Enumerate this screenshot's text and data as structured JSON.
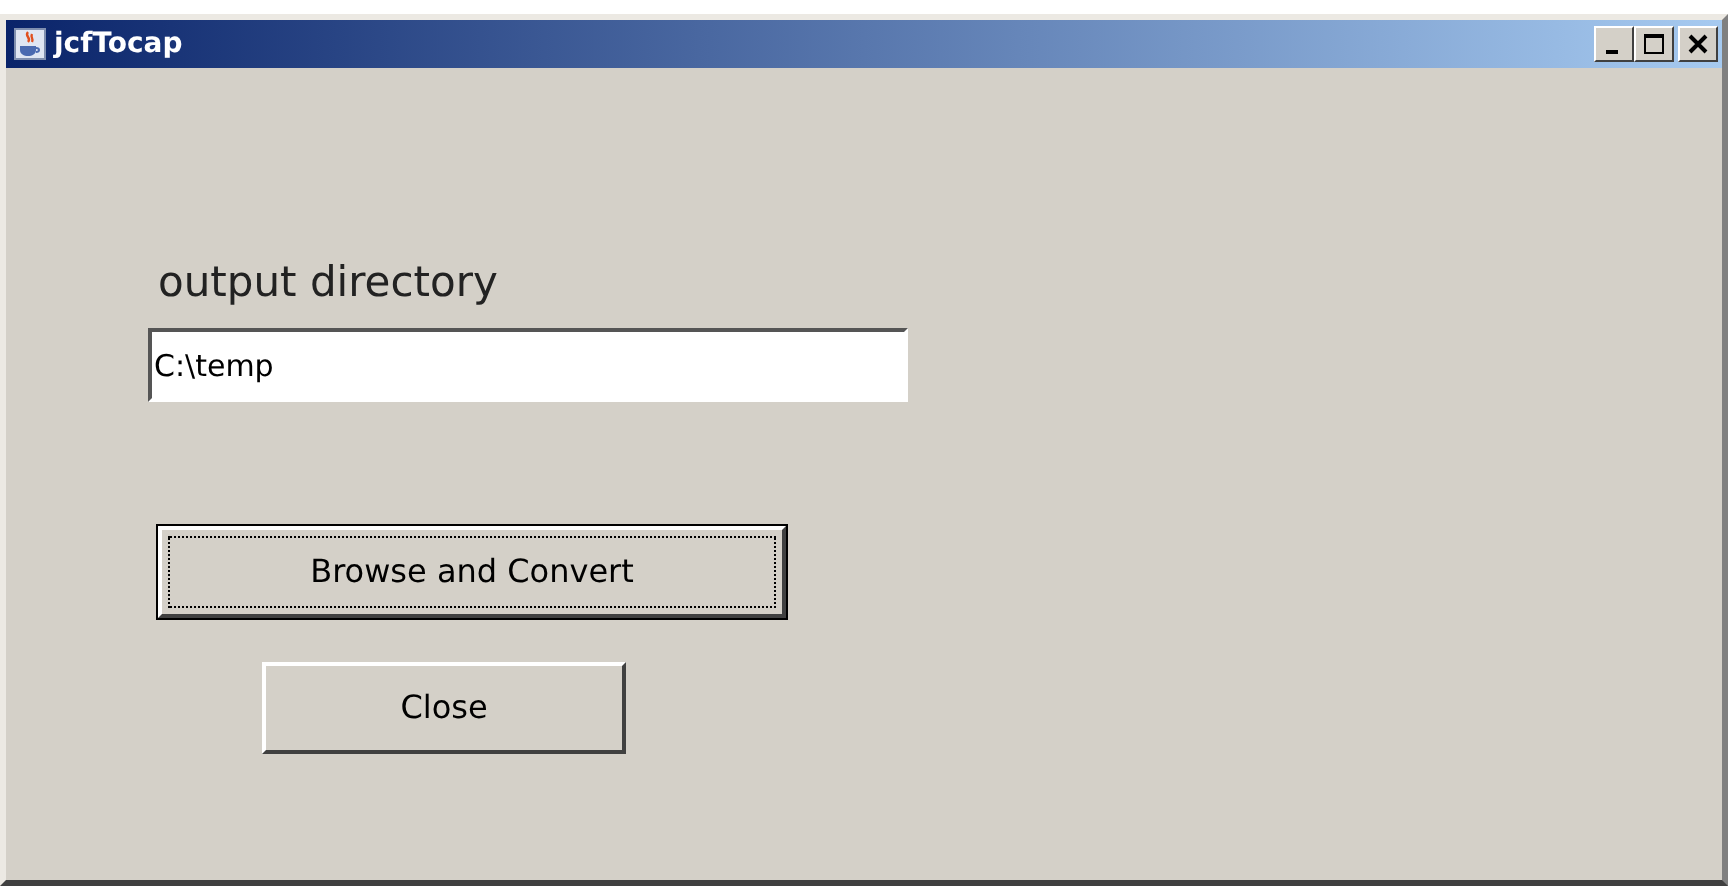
{
  "window": {
    "title": "jcfTocap"
  },
  "output_directory": {
    "label": "output directory",
    "value": "C:\\temp"
  },
  "buttons": [
    {
      "label": "Browse and Convert",
      "kind": "wide",
      "focused": true
    },
    {
      "label": "Close",
      "kind": "narrow",
      "focused": false
    }
  ]
}
